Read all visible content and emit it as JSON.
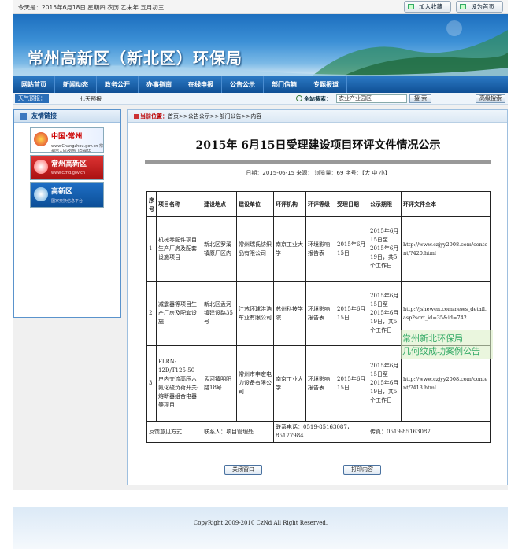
{
  "topbar": {
    "date": "今天是：2015年6月18日 星期四 农历 乙未年 五月初三",
    "add_fav": "加入收藏",
    "set_home": "设为首页"
  },
  "banner": {
    "title": "常州高新区（新北区）环保局"
  },
  "nav": [
    "网站首页",
    "新闻动态",
    "政务公开",
    "办事指南",
    "在线申报",
    "公告公示",
    "部门信箱",
    "专题报道"
  ],
  "infobar": {
    "weather": "天气预报：",
    "forecast": "七天预报",
    "search_label": "全站搜索：",
    "search_value": "农业产业园区",
    "search_btn": "搜 索",
    "adv_btn": "高级搜索"
  },
  "sidebar": {
    "title": "友情链接",
    "links": [
      {
        "big": "中国·常州",
        "small": "www.Changzhou.gov.cn 常州市人民政府门户网站"
      },
      {
        "big": "常州高新区",
        "small": "www.cznd.gov.cn"
      },
      {
        "big": "高新区",
        "small": "国家交换信息平台"
      }
    ]
  },
  "crumb": {
    "here": "当前位置：",
    "path": "首页>>公告公示>>部门公告>>内容"
  },
  "article": {
    "title": "2015年 6月15日受理建设项目环评文件情况公示",
    "meta": "日期：2015-06-15  来源：   浏览量：69  字号：【大 中 小】"
  },
  "table": {
    "headers": [
      "序号",
      "项目名称",
      "建设地点",
      "建设单位",
      "环评机构",
      "环评等级",
      "受理日期",
      "公示期限",
      "环评文件全本"
    ],
    "rows": [
      [
        "1",
        "机械零配件项目生产厂房及配套设施项目",
        "新北区罗溪镇原厂区内",
        "常州瑞氏纺织品有限公司",
        "南京工业大学",
        "环境影响报告表",
        "2015年6月15日",
        "2015年6月15日至2015年6月19日，共5个工作日",
        "http://www.czjyy2008.com/content/?420.html"
      ],
      [
        "2",
        "减震器等项目生产厂房及配套设施",
        "新北区孟河镇建设路35号",
        "江苏环球洪浩车业有限公司",
        "苏州科技学院",
        "环境影响报告表",
        "2015年6月15日",
        "2015年6月15日至2015年6月19日，共5个工作日",
        "http://jshewen.com/news_detail.asp?sort_id=35&id=742"
      ],
      [
        "3",
        "FLRN-12D/T125-50户内交流高压六氟化硫负荷开关-熔断器组合电器等项目",
        "孟河镇明阳路18号",
        "常州市申宏电力设备有限公司",
        "南京工业大学",
        "环境影响报告表",
        "2015年6月15日",
        "2015年6月15日至2015年6月19日，共5个工作日",
        "http://www.czjyy2008.com/content/?413.html"
      ]
    ],
    "feedback": {
      "label": "反馈意见方式",
      "contact": "联系人：项目管理处",
      "phone": "联系电话：0519-85163087，85177984",
      "fax": "传真：0519-85163087"
    }
  },
  "watermark": {
    "line1": "常州新北环保局",
    "line2": "几何纹成功案例公告"
  },
  "buttons": {
    "close": "关闭窗口",
    "print": "打印内容"
  },
  "footer": {
    "copyright": "CopyRight 2009-2010 CzNd All Right Reserved."
  }
}
